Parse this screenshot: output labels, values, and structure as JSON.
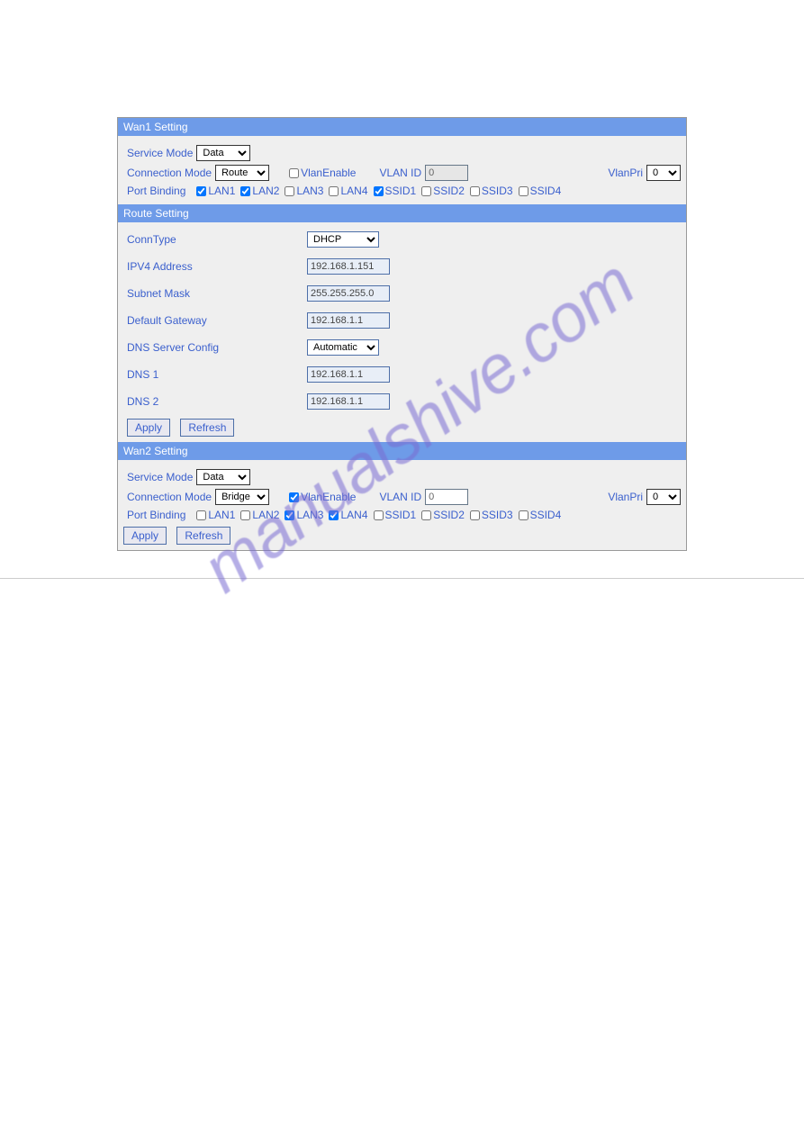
{
  "wan1": {
    "title": "Wan1 Setting",
    "service_mode_label": "Service Mode",
    "service_mode_value": "Data",
    "connection_mode_label": "Connection Mode",
    "connection_mode_value": "Route",
    "vlan_enable_label": "VlanEnable",
    "vlan_enable_checked": false,
    "vlan_id_label": "VLAN ID",
    "vlan_id_value": "0",
    "vlan_pri_label": "VlanPri",
    "vlan_pri_value": "0",
    "port_binding_label": "Port Binding",
    "ports": [
      {
        "label": "LAN1",
        "checked": true
      },
      {
        "label": "LAN2",
        "checked": true
      },
      {
        "label": "LAN3",
        "checked": false
      },
      {
        "label": "LAN4",
        "checked": false
      },
      {
        "label": "SSID1",
        "checked": true
      },
      {
        "label": "SSID2",
        "checked": false
      },
      {
        "label": "SSID3",
        "checked": false
      },
      {
        "label": "SSID4",
        "checked": false
      }
    ]
  },
  "route": {
    "title": "Route Setting",
    "fields": [
      {
        "label": "ConnType",
        "value": "DHCP",
        "type": "select"
      },
      {
        "label": "IPV4 Address",
        "value": "192.168.1.151",
        "type": "text"
      },
      {
        "label": "Subnet Mask",
        "value": "255.255.255.0",
        "type": "text"
      },
      {
        "label": "Default Gateway",
        "value": "192.168.1.1",
        "type": "text"
      },
      {
        "label": "DNS Server Config",
        "value": "Automatic",
        "type": "select"
      },
      {
        "label": "DNS 1",
        "value": "192.168.1.1",
        "type": "text"
      },
      {
        "label": "DNS 2",
        "value": "192.168.1.1",
        "type": "text"
      }
    ],
    "apply_label": "Apply",
    "refresh_label": "Refresh"
  },
  "wan2": {
    "title": "Wan2 Setting",
    "service_mode_label": "Service Mode",
    "service_mode_value": "Data",
    "connection_mode_label": "Connection Mode",
    "connection_mode_value": "Bridge",
    "vlan_enable_label": "VlanEnable",
    "vlan_enable_checked": true,
    "vlan_id_label": "VLAN ID",
    "vlan_id_value": "0",
    "vlan_pri_label": "VlanPri",
    "vlan_pri_value": "0",
    "port_binding_label": "Port Binding",
    "ports": [
      {
        "label": "LAN1",
        "checked": false
      },
      {
        "label": "LAN2",
        "checked": false
      },
      {
        "label": "LAN3",
        "checked": true
      },
      {
        "label": "LAN4",
        "checked": true
      },
      {
        "label": "SSID1",
        "checked": false
      },
      {
        "label": "SSID2",
        "checked": false
      },
      {
        "label": "SSID3",
        "checked": false
      },
      {
        "label": "SSID4",
        "checked": false
      }
    ],
    "apply_label": "Apply",
    "refresh_label": "Refresh"
  },
  "watermark": "manualshive.com"
}
